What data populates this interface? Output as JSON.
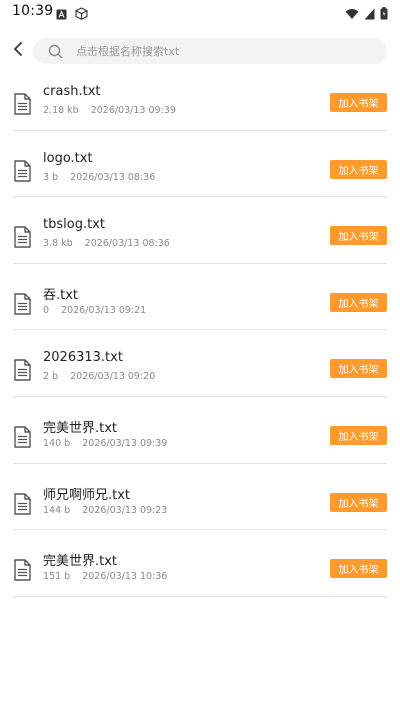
{
  "status_bar": {
    "time": "10:39",
    "icons": [
      "notification-a-icon",
      "cube-icon",
      "wifi-icon",
      "signal-icon",
      "battery-icon"
    ]
  },
  "header": {
    "back_icon": "back-arrow-icon",
    "search": {
      "icon": "search-icon",
      "placeholder": "点击根据名称搜索txt",
      "value": ""
    }
  },
  "files": [
    {
      "name": "crash.txt",
      "size": "2.18 kb",
      "date": "2026/03/13 09:39",
      "action": "加入书架"
    },
    {
      "name": "logo.txt",
      "size": "3 b",
      "date": "2026/03/13 08:36",
      "action": "加入书架"
    },
    {
      "name": "tbslog.txt",
      "size": "3.8 kb",
      "date": "2026/03/13 08:36",
      "action": "加入书架"
    },
    {
      "name": "吞.txt",
      "size": "0",
      "date": "2026/03/13 09:21",
      "action": "加入书架"
    },
    {
      "name": "2026313.txt",
      "size": "2 b",
      "date": "2026/03/13 09:20",
      "action": "加入书架"
    },
    {
      "name": "完美世界.txt",
      "size": "140 b",
      "date": "2026/03/13 09:39",
      "action": "加入书架"
    },
    {
      "name": "师兄啊师兄.txt",
      "size": "144 b",
      "date": "2026/03/13 09:23",
      "action": "加入书架"
    },
    {
      "name": "完美世界.txt",
      "size": "151 b",
      "date": "2026/03/13 10:36",
      "action": "加入书架"
    }
  ],
  "colors": {
    "accent": "#ff9a2e",
    "divider": "#e6e6e6",
    "search_bg": "#f3f3f3"
  }
}
